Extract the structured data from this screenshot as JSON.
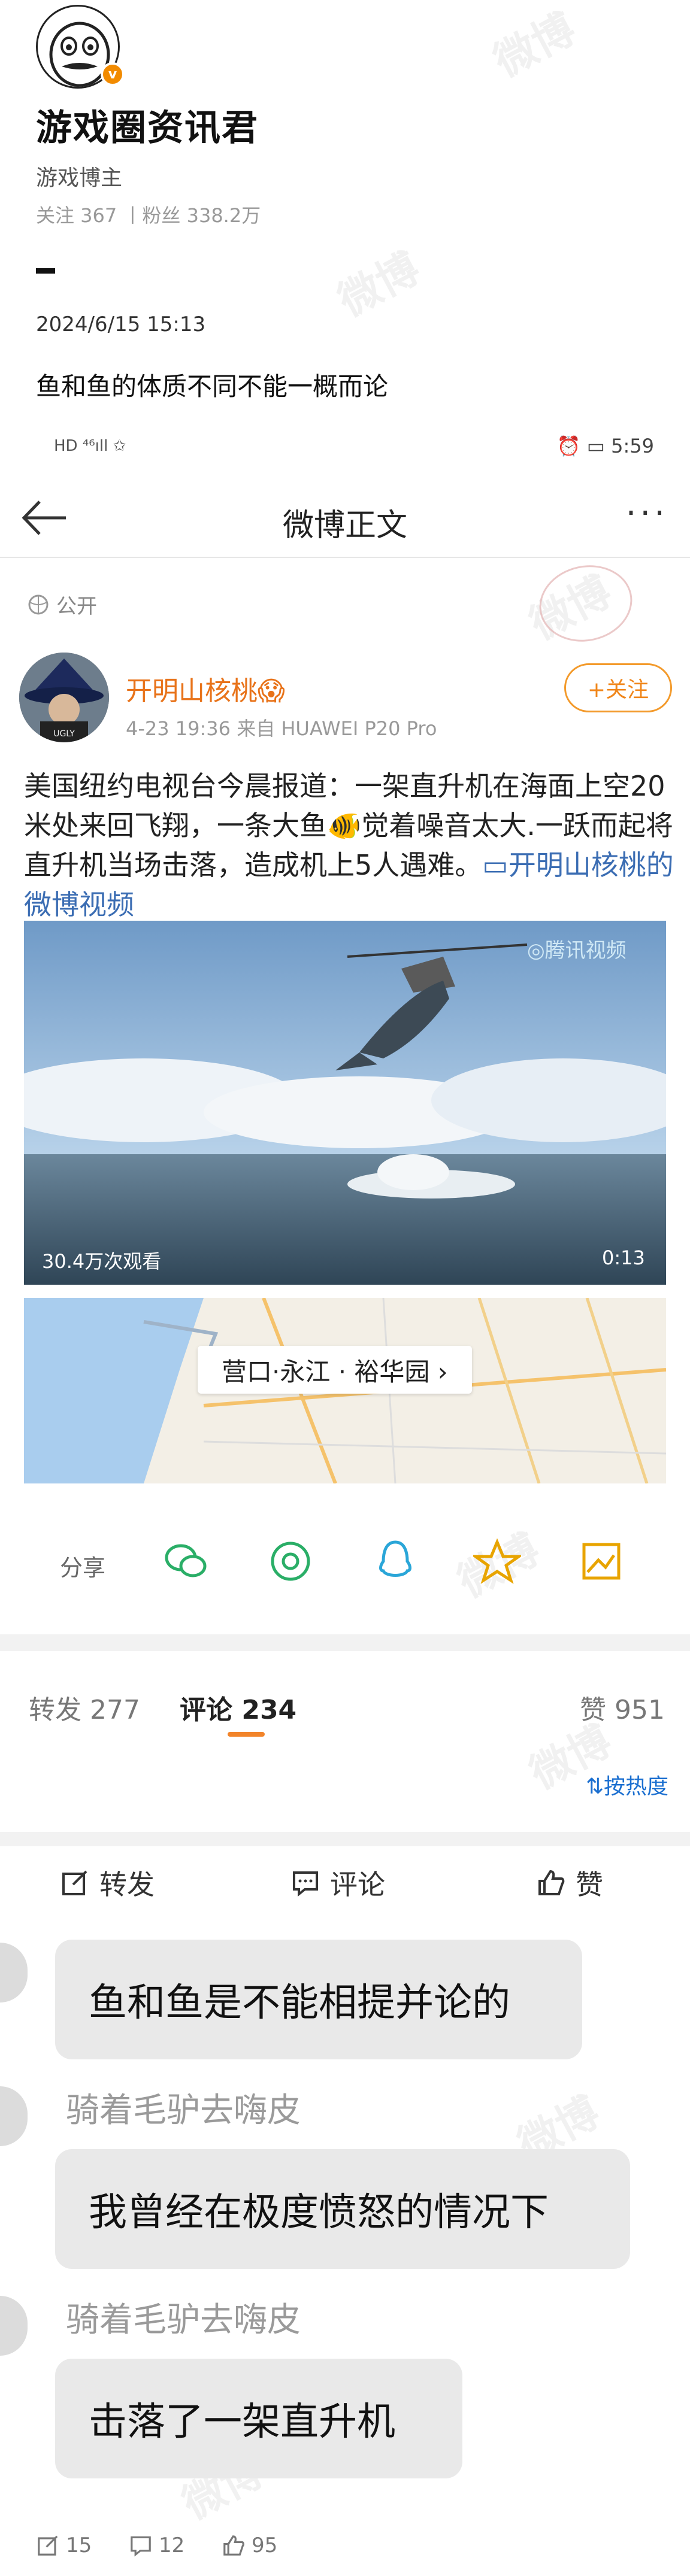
{
  "top_post": {
    "author_name": "游戏圈资讯君",
    "author_title": "游戏博主",
    "stats": "关注 367 丨粉丝 338.2万",
    "verified_badge": "v",
    "time": "2024/6/15 15:13",
    "text": "鱼和鱼的体质不同不能一概而论"
  },
  "status_bar": {
    "left": "HD ⁴⁶ıll ✩",
    "right": "⏰ ▭ 5:59"
  },
  "header": {
    "title": "微博正文",
    "back_icon": "arrow-left-icon",
    "more_label": "···"
  },
  "post": {
    "visibility": "公开",
    "author": "开明山核桃",
    "emoji_after_name": "😱",
    "meta": "4-23 19:36  来自 HUAWEI P20 Pro",
    "follow_label": "+关注",
    "text_before_emoji": "美国纽约电视台今晨报道：一架直升机在海面上空20米处来回飞翔，一条大鱼",
    "emoji": "🐠",
    "text_after_emoji": "觉着噪音太大.一跃而起将直升机当场击落，造成机上5人遇难。",
    "link_text": "▭开明山核桃的微博视频",
    "video": {
      "views": "30.4万次观看",
      "duration": "0:13",
      "source_logo": "◎腾讯视频"
    },
    "location": "营口·永江 · 裕华园 ›"
  },
  "share": {
    "label": "分享",
    "icons": [
      "wechat-icon",
      "moments-icon",
      "qq-icon",
      "qzone-icon",
      "save-image-icon"
    ]
  },
  "tabs": [
    {
      "label": "转发",
      "count": "277",
      "active": false
    },
    {
      "label": "评论",
      "count": "234",
      "active": true
    },
    {
      "label": "赞",
      "count": "951",
      "active": false
    }
  ],
  "sort_label": "⇅按热度",
  "actions": [
    {
      "label": "转发",
      "icon": "repost-icon"
    },
    {
      "label": "评论",
      "icon": "comment-icon"
    },
    {
      "label": "赞",
      "icon": "like-icon"
    }
  ],
  "chat": [
    {
      "name": "",
      "text": "鱼和鱼是不能相提并论的"
    },
    {
      "name": "骑着毛驴去嗨皮",
      "text": "我曾经在极度愤怒的情况下"
    },
    {
      "name": "骑着毛驴去嗨皮",
      "text": "击落了一架直升机"
    }
  ],
  "footer": {
    "repost": "15",
    "comment": "12",
    "like": "95"
  },
  "colors": {
    "accent_orange": "#f2842a",
    "link_blue": "#3b6db3",
    "name_orange": "#e8731a"
  }
}
